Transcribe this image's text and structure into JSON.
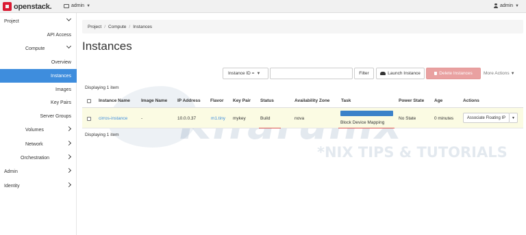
{
  "topbar": {
    "brand": "openstack.",
    "project": "admin",
    "user": "admin"
  },
  "sidebar": {
    "items": [
      {
        "label": "Project",
        "chevron": "down"
      },
      {
        "label": "API Access"
      },
      {
        "label": "Compute",
        "chevron": "down"
      },
      {
        "label": "Overview"
      },
      {
        "label": "Instances",
        "active": true
      },
      {
        "label": "Images"
      },
      {
        "label": "Key Pairs"
      },
      {
        "label": "Server Groups"
      },
      {
        "label": "Volumes",
        "chevron": "right"
      },
      {
        "label": "Network",
        "chevron": "right"
      },
      {
        "label": "Orchestration",
        "chevron": "right"
      },
      {
        "label": "Admin",
        "chevron": "right"
      },
      {
        "label": "Identity",
        "chevron": "right"
      }
    ]
  },
  "breadcrumb": {
    "project": "Project",
    "compute": "Compute",
    "current": "Instances"
  },
  "page_title": "Instances",
  "toolbar": {
    "filter_field": "Instance ID =",
    "filter_value": "",
    "filter_label": "Filter",
    "launch_label": "Launch Instance",
    "delete_label": "Delete Instances",
    "more_label": "More Actions"
  },
  "displaying_top": "Displaying 1 item",
  "displaying_bottom": "Displaying 1 item",
  "table": {
    "headers": {
      "name": "Instance Name",
      "image": "Image Name",
      "ip": "IP Address",
      "flavor": "Flavor",
      "keypair": "Key Pair",
      "status": "Status",
      "az": "Availability Zone",
      "task": "Task",
      "power": "Power State",
      "age": "Age",
      "actions": "Actions"
    },
    "rows": [
      {
        "name": "cirros-instance",
        "image": "-",
        "ip": "10.0.0.37",
        "flavor": "m1.tiny",
        "keypair": "mykey",
        "status": "Build",
        "az": "nova",
        "task": "Block Device Mapping",
        "power": "No State",
        "age": "0 minutes",
        "action": "Associate Floating IP"
      }
    ]
  },
  "watermark": {
    "main": "Kifarunix",
    "sub": "*NIX TIPS & TUTORIALS"
  },
  "colors": {
    "accent": "#3e8ddd",
    "danger": "#e9a1a1",
    "brand": "#da1a32",
    "progress": "#3b82c9"
  }
}
